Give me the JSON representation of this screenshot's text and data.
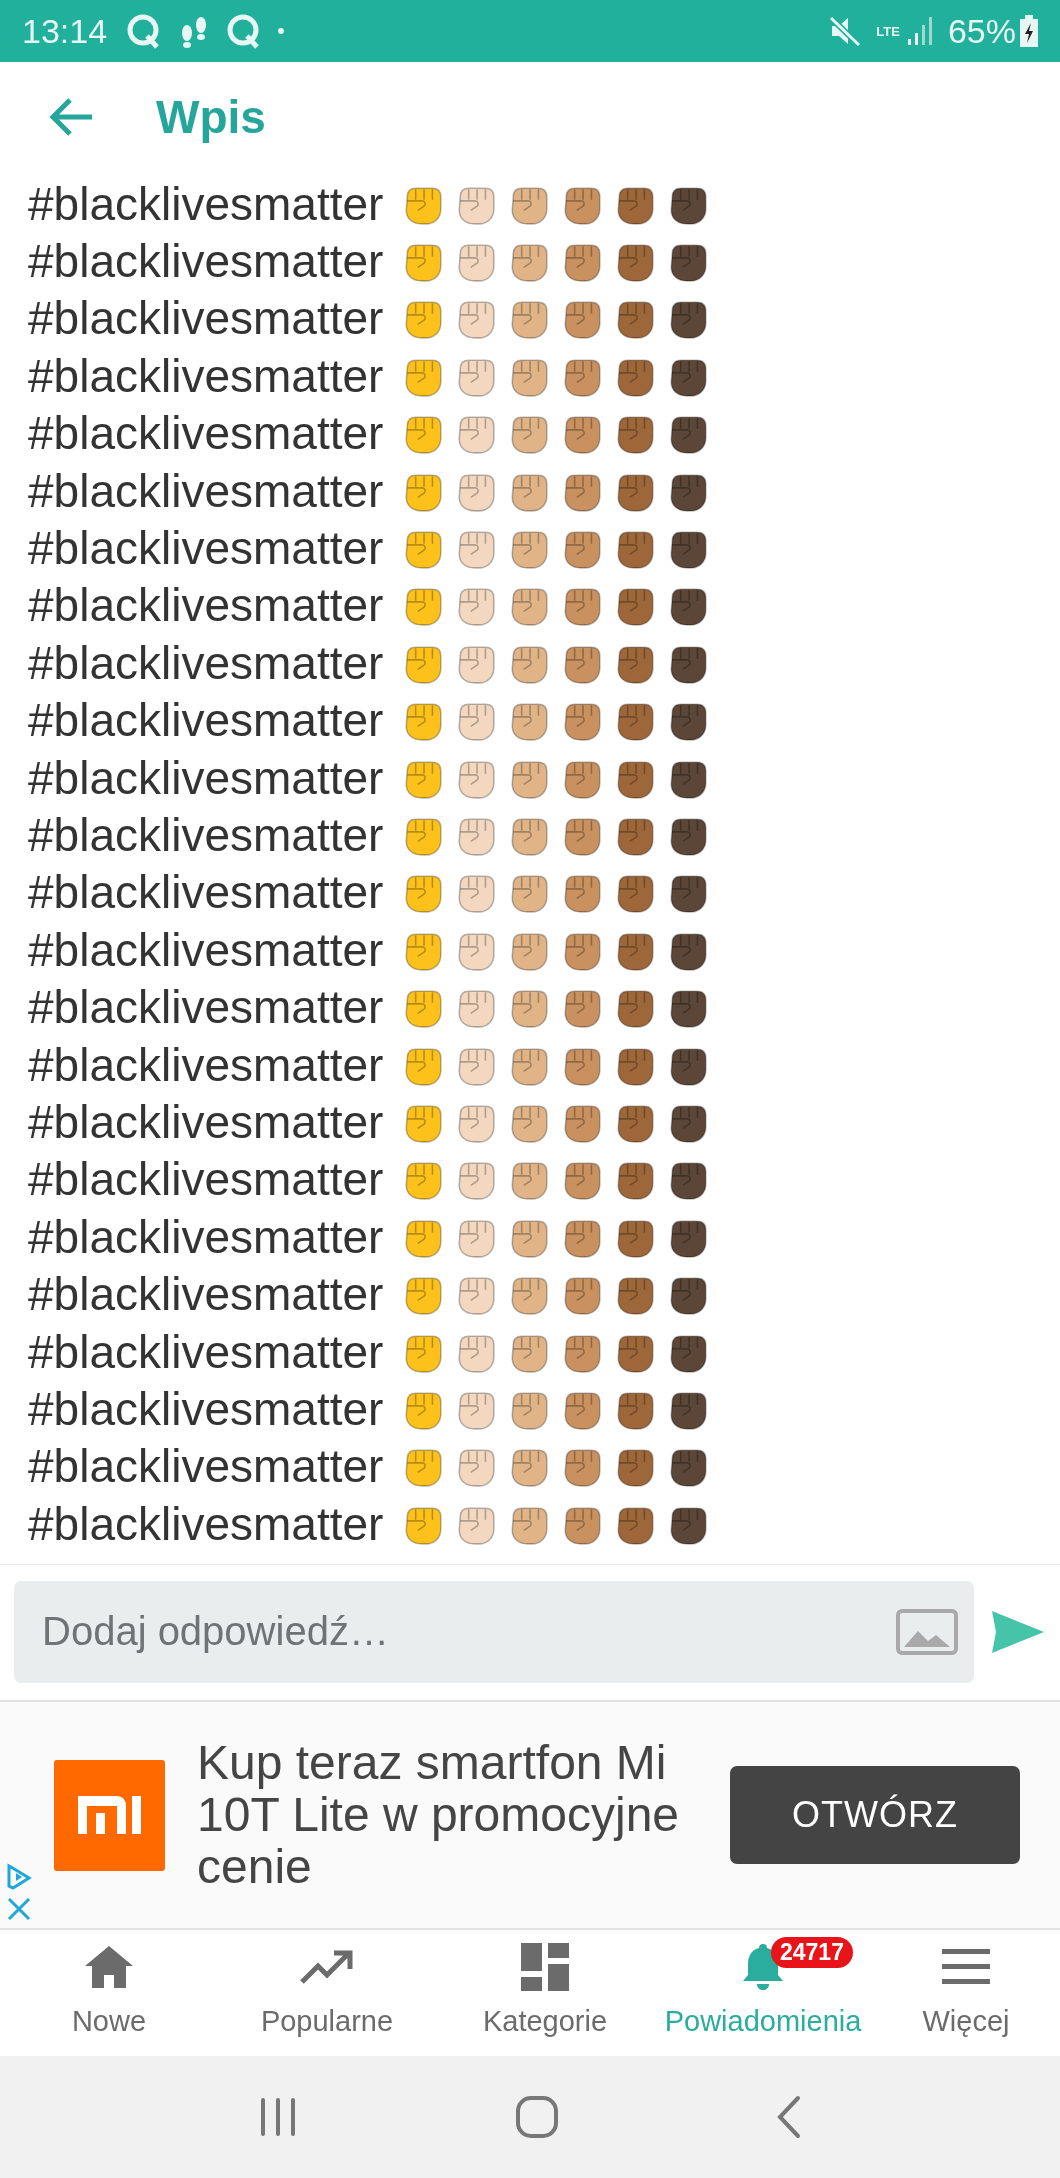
{
  "status_bar": {
    "time": "13:14",
    "network": "LTE",
    "battery": "65%"
  },
  "header": {
    "title": "Wpis"
  },
  "rows": [
    {
      "text": "#blacklivesmatter",
      "fists": [
        {
          "color": "#fcc21b"
        },
        {
          "color": "#f3d8bf"
        },
        {
          "color": "#e0b487"
        },
        {
          "color": "#c8915f"
        },
        {
          "color": "#9e6739"
        },
        {
          "color": "#5b4637"
        }
      ]
    },
    {
      "text": "#blacklivesmatter",
      "fists": [
        {
          "color": "#fcc21b"
        },
        {
          "color": "#f3d8bf"
        },
        {
          "color": "#e0b487"
        },
        {
          "color": "#c8915f"
        },
        {
          "color": "#9e6739"
        },
        {
          "color": "#5b4637"
        }
      ]
    },
    {
      "text": "#blacklivesmatter",
      "fists": [
        {
          "color": "#fcc21b"
        },
        {
          "color": "#f3d8bf"
        },
        {
          "color": "#e0b487"
        },
        {
          "color": "#c8915f"
        },
        {
          "color": "#9e6739"
        },
        {
          "color": "#5b4637"
        }
      ]
    },
    {
      "text": "#blacklivesmatter",
      "fists": [
        {
          "color": "#fcc21b"
        },
        {
          "color": "#f3d8bf"
        },
        {
          "color": "#e0b487"
        },
        {
          "color": "#c8915f"
        },
        {
          "color": "#9e6739"
        },
        {
          "color": "#5b4637"
        }
      ]
    },
    {
      "text": "#blacklivesmatter",
      "fists": [
        {
          "color": "#fcc21b"
        },
        {
          "color": "#f3d8bf"
        },
        {
          "color": "#e0b487"
        },
        {
          "color": "#c8915f"
        },
        {
          "color": "#9e6739"
        },
        {
          "color": "#5b4637"
        }
      ]
    },
    {
      "text": "#blacklivesmatter",
      "fists": [
        {
          "color": "#fcc21b"
        },
        {
          "color": "#f3d8bf"
        },
        {
          "color": "#e0b487"
        },
        {
          "color": "#c8915f"
        },
        {
          "color": "#9e6739"
        },
        {
          "color": "#5b4637"
        }
      ]
    },
    {
      "text": "#blacklivesmatter",
      "fists": [
        {
          "color": "#fcc21b"
        },
        {
          "color": "#f3d8bf"
        },
        {
          "color": "#e0b487"
        },
        {
          "color": "#c8915f"
        },
        {
          "color": "#9e6739"
        },
        {
          "color": "#5b4637"
        }
      ]
    },
    {
      "text": "#blacklivesmatter",
      "fists": [
        {
          "color": "#fcc21b"
        },
        {
          "color": "#f3d8bf"
        },
        {
          "color": "#e0b487"
        },
        {
          "color": "#c8915f"
        },
        {
          "color": "#9e6739"
        },
        {
          "color": "#5b4637"
        }
      ]
    },
    {
      "text": "#blacklivesmatter",
      "fists": [
        {
          "color": "#fcc21b"
        },
        {
          "color": "#f3d8bf"
        },
        {
          "color": "#e0b487"
        },
        {
          "color": "#c8915f"
        },
        {
          "color": "#9e6739"
        },
        {
          "color": "#5b4637"
        }
      ]
    },
    {
      "text": "#blacklivesmatter",
      "fists": [
        {
          "color": "#fcc21b"
        },
        {
          "color": "#f3d8bf"
        },
        {
          "color": "#e0b487"
        },
        {
          "color": "#c8915f"
        },
        {
          "color": "#9e6739"
        },
        {
          "color": "#5b4637"
        }
      ]
    },
    {
      "text": "#blacklivesmatter",
      "fists": [
        {
          "color": "#fcc21b"
        },
        {
          "color": "#f3d8bf"
        },
        {
          "color": "#e0b487"
        },
        {
          "color": "#c8915f"
        },
        {
          "color": "#9e6739"
        },
        {
          "color": "#5b4637"
        }
      ]
    },
    {
      "text": "#blacklivesmatter",
      "fists": [
        {
          "color": "#fcc21b"
        },
        {
          "color": "#f3d8bf"
        },
        {
          "color": "#e0b487"
        },
        {
          "color": "#c8915f"
        },
        {
          "color": "#9e6739"
        },
        {
          "color": "#5b4637"
        }
      ]
    },
    {
      "text": "#blacklivesmatter",
      "fists": [
        {
          "color": "#fcc21b"
        },
        {
          "color": "#f3d8bf"
        },
        {
          "color": "#e0b487"
        },
        {
          "color": "#c8915f"
        },
        {
          "color": "#9e6739"
        },
        {
          "color": "#5b4637"
        }
      ]
    },
    {
      "text": "#blacklivesmatter",
      "fists": [
        {
          "color": "#fcc21b"
        },
        {
          "color": "#f3d8bf"
        },
        {
          "color": "#e0b487"
        },
        {
          "color": "#c8915f"
        },
        {
          "color": "#9e6739"
        },
        {
          "color": "#5b4637"
        }
      ]
    },
    {
      "text": "#blacklivesmatter",
      "fists": [
        {
          "color": "#fcc21b"
        },
        {
          "color": "#f3d8bf"
        },
        {
          "color": "#e0b487"
        },
        {
          "color": "#c8915f"
        },
        {
          "color": "#9e6739"
        },
        {
          "color": "#5b4637"
        }
      ]
    },
    {
      "text": "#blacklivesmatter",
      "fists": [
        {
          "color": "#fcc21b"
        },
        {
          "color": "#f3d8bf"
        },
        {
          "color": "#e0b487"
        },
        {
          "color": "#c8915f"
        },
        {
          "color": "#9e6739"
        },
        {
          "color": "#5b4637"
        }
      ]
    },
    {
      "text": "#blacklivesmatter",
      "fists": [
        {
          "color": "#fcc21b"
        },
        {
          "color": "#f3d8bf"
        },
        {
          "color": "#e0b487"
        },
        {
          "color": "#c8915f"
        },
        {
          "color": "#9e6739"
        },
        {
          "color": "#5b4637"
        }
      ]
    },
    {
      "text": "#blacklivesmatter",
      "fists": [
        {
          "color": "#fcc21b"
        },
        {
          "color": "#f3d8bf"
        },
        {
          "color": "#e0b487"
        },
        {
          "color": "#c8915f"
        },
        {
          "color": "#9e6739"
        },
        {
          "color": "#5b4637"
        }
      ]
    },
    {
      "text": "#blacklivesmatter",
      "fists": [
        {
          "color": "#fcc21b"
        },
        {
          "color": "#f3d8bf"
        },
        {
          "color": "#e0b487"
        },
        {
          "color": "#c8915f"
        },
        {
          "color": "#9e6739"
        },
        {
          "color": "#5b4637"
        }
      ]
    },
    {
      "text": "#blacklivesmatter",
      "fists": [
        {
          "color": "#fcc21b"
        },
        {
          "color": "#f3d8bf"
        },
        {
          "color": "#e0b487"
        },
        {
          "color": "#c8915f"
        },
        {
          "color": "#9e6739"
        },
        {
          "color": "#5b4637"
        }
      ]
    },
    {
      "text": "#blacklivesmatter",
      "fists": [
        {
          "color": "#fcc21b"
        },
        {
          "color": "#f3d8bf"
        },
        {
          "color": "#e0b487"
        },
        {
          "color": "#c8915f"
        },
        {
          "color": "#9e6739"
        },
        {
          "color": "#5b4637"
        }
      ]
    },
    {
      "text": "#blacklivesmatter",
      "fists": [
        {
          "color": "#fcc21b"
        },
        {
          "color": "#f3d8bf"
        },
        {
          "color": "#e0b487"
        },
        {
          "color": "#c8915f"
        },
        {
          "color": "#9e6739"
        },
        {
          "color": "#5b4637"
        }
      ]
    },
    {
      "text": "#blacklivesmatter",
      "fists": [
        {
          "color": "#fcc21b"
        },
        {
          "color": "#f3d8bf"
        },
        {
          "color": "#e0b487"
        },
        {
          "color": "#c8915f"
        },
        {
          "color": "#9e6739"
        },
        {
          "color": "#5b4637"
        }
      ]
    },
    {
      "text": "#blacklivesmatter",
      "fists": [
        {
          "color": "#fcc21b"
        },
        {
          "color": "#f3d8bf"
        },
        {
          "color": "#e0b487"
        },
        {
          "color": "#c8915f"
        },
        {
          "color": "#9e6739"
        },
        {
          "color": "#5b4637"
        }
      ]
    }
  ],
  "reply": {
    "placeholder": "Dodaj odpowiedź…"
  },
  "ad": {
    "lines": [
      "Kup teraz smartfon Mi",
      "10T Lite w promocyjne",
      "cenie"
    ],
    "button": "OTWÓRZ"
  },
  "nav": [
    {
      "label": "Nowe",
      "selected": false
    },
    {
      "label": "Popularne",
      "selected": false
    },
    {
      "label": "Kategorie",
      "selected": false
    },
    {
      "label": "Powiadomienia",
      "selected": true,
      "badge": "24717"
    },
    {
      "label": "Więcej",
      "selected": false
    }
  ]
}
